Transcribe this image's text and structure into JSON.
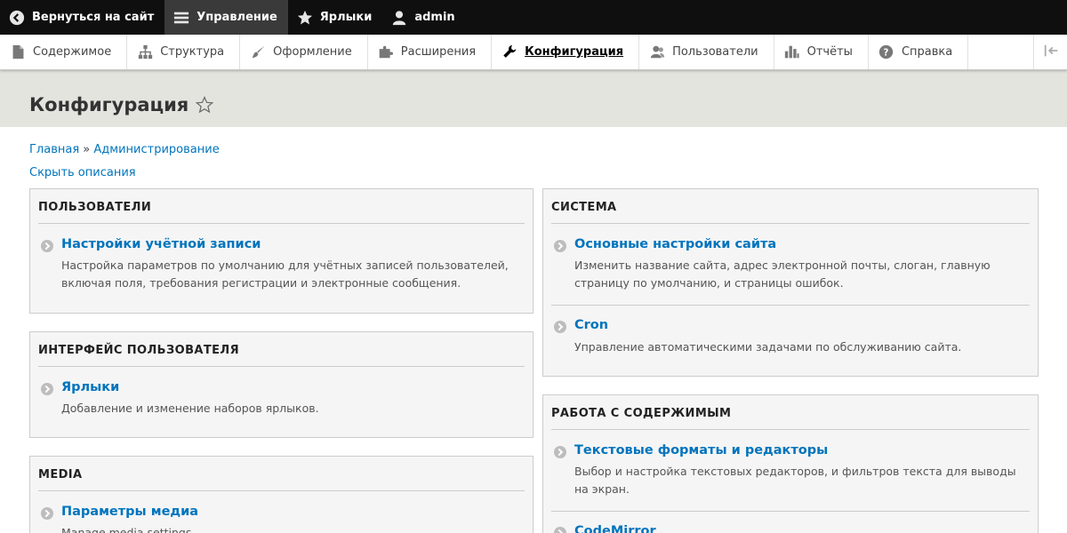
{
  "toolbar": {
    "back": "Вернуться на сайт",
    "manage": "Управление",
    "shortcuts": "Ярлыки",
    "user": "admin"
  },
  "tray": {
    "items": [
      {
        "label": "Содержимое",
        "icon": "file-icon"
      },
      {
        "label": "Структура",
        "icon": "structure-icon"
      },
      {
        "label": "Оформление",
        "icon": "brush-icon"
      },
      {
        "label": "Расширения",
        "icon": "puzzle-icon"
      },
      {
        "label": "Конфигурация",
        "icon": "wrench-icon",
        "active": true
      },
      {
        "label": "Пользователи",
        "icon": "people-icon"
      },
      {
        "label": "Отчёты",
        "icon": "bar-chart-icon"
      },
      {
        "label": "Справка",
        "icon": "help-icon"
      }
    ]
  },
  "page": {
    "title": "Конфигурация",
    "breadcrumb": [
      "Главная",
      "Администрирование"
    ],
    "breadcrumb_sep": "»",
    "hide_descriptions": "Скрыть описания"
  },
  "panels": {
    "users": {
      "title": "ПОЛЬЗОВАТЕЛИ",
      "items": [
        {
          "link": "Настройки учётной записи",
          "desc_lines": [
            "Настройка параметров по умолчанию для учётных записей пользователей,",
            "включая поля, требования регистрации и электронные сообщения."
          ]
        }
      ]
    },
    "ui": {
      "title": "ИНТЕРФЕЙС ПОЛЬЗОВАТЕЛЯ",
      "items": [
        {
          "link": "Ярлыки",
          "desc_lines": [
            "Добавление и изменение наборов ярлыков."
          ]
        }
      ]
    },
    "media": {
      "title": "MEDIA",
      "items": [
        {
          "link": "Параметры медиа",
          "desc_lines": [
            "Manage media settings."
          ]
        }
      ]
    },
    "system": {
      "title": "СИСТЕМА",
      "items": [
        {
          "link": "Основные настройки сайта",
          "desc_lines": [
            "Изменить название сайта, адрес электронной почты, слоган, главную",
            "страницу по умолчанию, и страницы ошибок."
          ]
        },
        {
          "link": "Cron",
          "desc_lines": [
            "Управление автоматическими задачами по обслуживанию сайта."
          ]
        }
      ]
    },
    "content": {
      "title": "РАБОТА С СОДЕРЖИМЫМ",
      "items": [
        {
          "link": "Текстовые форматы и редакторы",
          "desc_lines": [
            "Выбор и настройка текстовых редакторов, и фильтров текста для выводы",
            "на экран."
          ]
        },
        {
          "link": "CodeMirror",
          "desc_lines": []
        }
      ]
    }
  },
  "colors": {
    "toolbar_bg": "#0f0f0f",
    "link": "#0074bd",
    "header_bg": "#e4e4df",
    "panel_bg": "#f5f5f5"
  }
}
